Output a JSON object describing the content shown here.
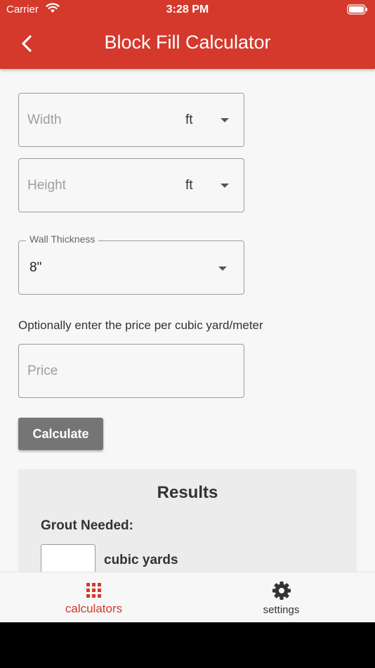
{
  "status_bar": {
    "carrier": "Carrier",
    "time": "3:28 PM"
  },
  "header": {
    "title": "Block Fill Calculator"
  },
  "form": {
    "width": {
      "placeholder": "Width",
      "unit": "ft"
    },
    "height": {
      "placeholder": "Height",
      "unit": "ft"
    },
    "wall_thickness": {
      "label": "Wall Thickness",
      "value": "8\""
    },
    "hint": "Optionally enter the price per cubic yard/meter",
    "price": {
      "placeholder": "Price"
    },
    "calculate_label": "Calculate"
  },
  "results": {
    "title": "Results",
    "grout_label": "Grout Needed:",
    "unit": "cubic yards"
  },
  "tabs": [
    {
      "label": "calculators",
      "icon": "grid-icon",
      "active": true
    },
    {
      "label": "settings",
      "icon": "gear-icon",
      "active": false
    }
  ],
  "colors": {
    "accent": "#d4392b",
    "button": "#757575"
  }
}
